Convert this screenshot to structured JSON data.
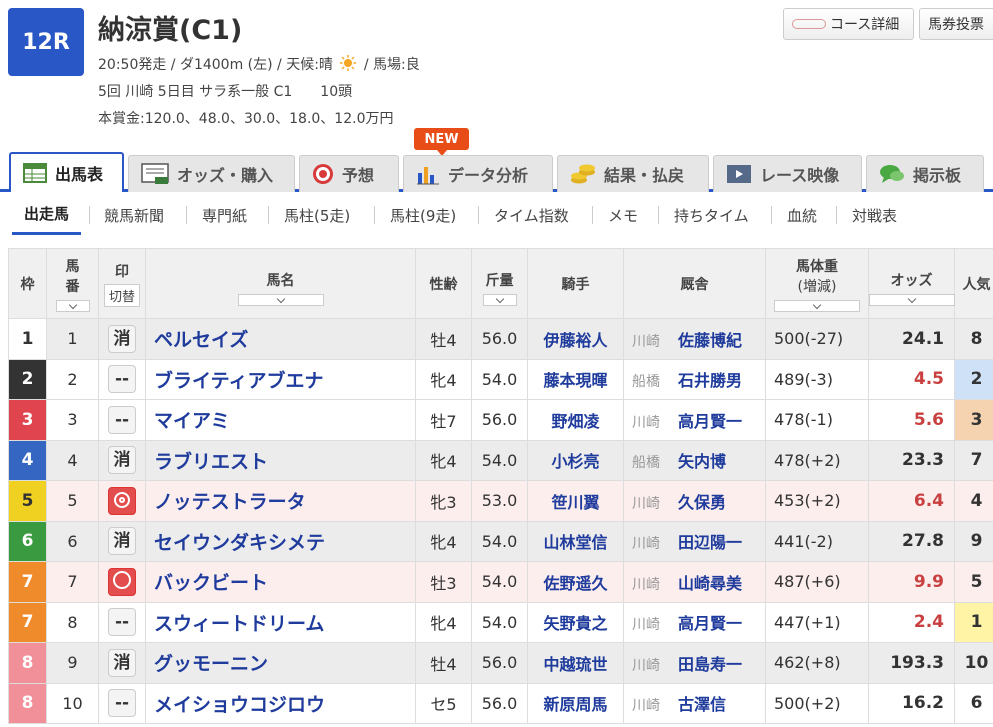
{
  "race": {
    "number": "12R",
    "name": "納涼賞(C1)",
    "start_info": "20:50発走 / ダ1400m (左) / 天候:晴",
    "track_info": "/ 馬場:良",
    "meeting": "5回 川崎 5日目 サラ系一般 C1　　10頭",
    "prize": "本賞金:120.0、48.0、30.0、18.0、12.0万円"
  },
  "buttons": {
    "course_detail": "コース詳細",
    "betting": "馬券投票"
  },
  "new_badge": "NEW",
  "tabs": [
    {
      "label": "出馬表",
      "icon": "table-icon"
    },
    {
      "label": "オッズ・購入",
      "icon": "ipat-icon"
    },
    {
      "label": "予想",
      "icon": "target-icon"
    },
    {
      "label": "データ分析",
      "icon": "bar-chart-icon"
    },
    {
      "label": "結果・払戻",
      "icon": "coins-icon"
    },
    {
      "label": "レース映像",
      "icon": "video-icon"
    },
    {
      "label": "掲示板",
      "icon": "chat-icon"
    }
  ],
  "subtabs": [
    "出走馬",
    "競馬新聞",
    "専門紙",
    "馬柱(5走)",
    "馬柱(9走)",
    "タイム指数",
    "メモ",
    "持ちタイム",
    "血統",
    "対戦表"
  ],
  "table": {
    "headers": {
      "waku": "枠",
      "umaban_1": "馬",
      "umaban_2": "番",
      "mark": "印",
      "mark_toggle": "切替",
      "name": "馬名",
      "sexage": "性齢",
      "weight": "斤量",
      "jockey": "騎手",
      "stable": "厩舎",
      "body_1": "馬体重",
      "body_2": "(増減)",
      "odds": "オッズ",
      "pop": "人気"
    },
    "colors": {
      "waku": {
        "1": "#ffffff",
        "2": "#333333",
        "3": "#e0454f",
        "4": "#3466c2",
        "5": "#f0d020",
        "6": "#3a9a40",
        "7": "#f08b2c",
        "8": "#f2909a"
      },
      "row_gray": "#ececec",
      "row_pink": "#fdeeee",
      "pop_1": "#fff3a6",
      "pop_2": "#cfe1f7",
      "pop_3": "#f5d3b0"
    },
    "rows": [
      {
        "waku": "1",
        "umaban": "1",
        "mark": "消",
        "mark_type": "plain",
        "name": "ペルセイズ",
        "sexage": "牡4",
        "weight": "56.0",
        "jockey": "伊藤裕人",
        "area": "川崎",
        "trainer": "佐藤博紀",
        "body": "500(-27)",
        "odds": "24.1",
        "pop": "8",
        "hot": false,
        "bg": "gray"
      },
      {
        "waku": "2",
        "umaban": "2",
        "mark": "--",
        "mark_type": "plain",
        "name": "ブライティアブエナ",
        "sexage": "牝4",
        "weight": "54.0",
        "jockey": "藤本現暉",
        "area": "船橋",
        "trainer": "石井勝男",
        "body": "489(-3)",
        "odds": "4.5",
        "pop": "2",
        "hot": true,
        "bg": "white"
      },
      {
        "waku": "3",
        "umaban": "3",
        "mark": "--",
        "mark_type": "plain",
        "name": "マイアミ",
        "sexage": "牡7",
        "weight": "56.0",
        "jockey": "野畑凌",
        "area": "川崎",
        "trainer": "高月賢一",
        "body": "478(-1)",
        "odds": "5.6",
        "pop": "3",
        "hot": true,
        "bg": "white"
      },
      {
        "waku": "4",
        "umaban": "4",
        "mark": "消",
        "mark_type": "plain",
        "name": "ラブリエスト",
        "sexage": "牝4",
        "weight": "54.0",
        "jockey": "小杉亮",
        "area": "船橋",
        "trainer": "矢内博",
        "body": "478(+2)",
        "odds": "23.3",
        "pop": "7",
        "hot": false,
        "bg": "gray"
      },
      {
        "waku": "5",
        "umaban": "5",
        "mark": "◎",
        "mark_type": "double",
        "name": "ノッテストラータ",
        "sexage": "牝3",
        "weight": "53.0",
        "jockey": "笹川翼",
        "area": "川崎",
        "trainer": "久保勇",
        "body": "453(+2)",
        "odds": "6.4",
        "pop": "4",
        "hot": true,
        "bg": "pink"
      },
      {
        "waku": "6",
        "umaban": "6",
        "mark": "消",
        "mark_type": "plain",
        "name": "セイウンダキシメテ",
        "sexage": "牝4",
        "weight": "54.0",
        "jockey": "山林堂信",
        "area": "川崎",
        "trainer": "田辺陽一",
        "body": "441(-2)",
        "odds": "27.8",
        "pop": "9",
        "hot": false,
        "bg": "gray"
      },
      {
        "waku": "7",
        "umaban": "7",
        "mark": "○",
        "mark_type": "single",
        "name": "バックビート",
        "sexage": "牡3",
        "weight": "54.0",
        "jockey": "佐野遥久",
        "area": "川崎",
        "trainer": "山崎尋美",
        "body": "487(+6)",
        "odds": "9.9",
        "pop": "5",
        "hot": true,
        "bg": "pink"
      },
      {
        "waku": "7",
        "umaban": "8",
        "mark": "--",
        "mark_type": "plain",
        "name": "スウィートドリーム",
        "sexage": "牝4",
        "weight": "54.0",
        "jockey": "矢野貴之",
        "area": "川崎",
        "trainer": "高月賢一",
        "body": "447(+1)",
        "odds": "2.4",
        "pop": "1",
        "hot": true,
        "bg": "white"
      },
      {
        "waku": "8",
        "umaban": "9",
        "mark": "消",
        "mark_type": "plain",
        "name": "グッモーニン",
        "sexage": "牡4",
        "weight": "56.0",
        "jockey": "中越琉世",
        "area": "川崎",
        "trainer": "田島寿一",
        "body": "462(+8)",
        "odds": "193.3",
        "pop": "10",
        "hot": false,
        "bg": "gray"
      },
      {
        "waku": "8",
        "umaban": "10",
        "mark": "--",
        "mark_type": "plain",
        "name": "メイショウコジロウ",
        "sexage": "セ5",
        "weight": "56.0",
        "jockey": "新原周馬",
        "area": "川崎",
        "trainer": "古澤信",
        "body": "500(+2)",
        "odds": "16.2",
        "pop": "6",
        "hot": false,
        "bg": "white"
      }
    ]
  }
}
